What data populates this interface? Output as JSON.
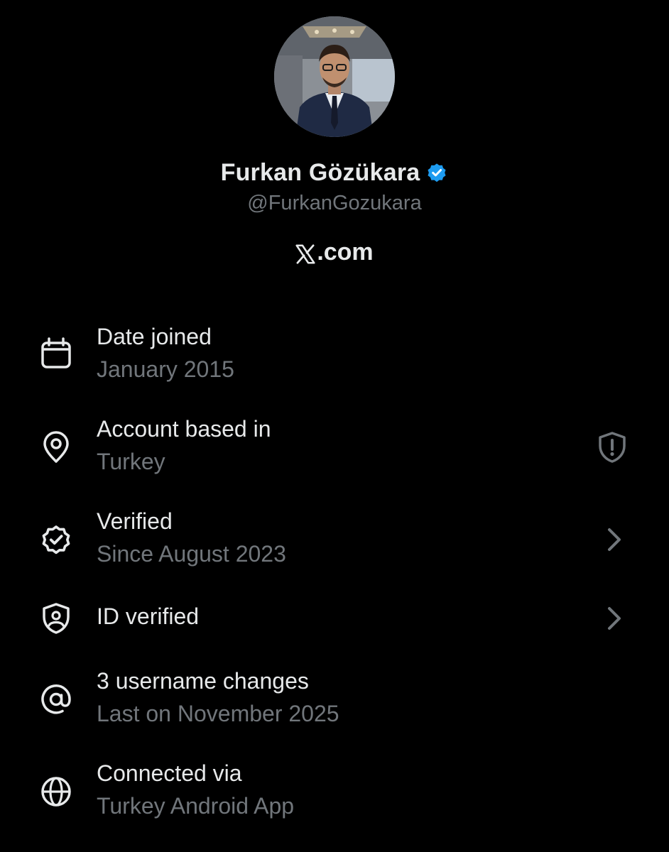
{
  "profile": {
    "display_name": "Furkan Gözükara",
    "handle": "@FurkanGozukara",
    "avatar_icon": "profile-photo",
    "verified_badge_icon": "verified-checkmark-icon",
    "badge_color": "#1d9bf0"
  },
  "brand": {
    "logo_icon": "x-logo-icon",
    "suffix": ".com"
  },
  "details": {
    "date_joined": {
      "title": "Date joined",
      "value": "January 2015",
      "icon": "calendar-icon"
    },
    "account_based": {
      "title": "Account based in",
      "value": "Turkey",
      "icon": "location-pin-icon",
      "trailing_icon": "shield-alert-icon"
    },
    "verified": {
      "title": "Verified",
      "value": "Since August 2023",
      "icon": "verified-badge-icon",
      "trailing_icon": "chevron-right-icon"
    },
    "id_verified": {
      "title": "ID verified",
      "icon": "id-shield-icon",
      "trailing_icon": "chevron-right-icon"
    },
    "username_changes": {
      "title": "3 username changes",
      "value": "Last on November 2025",
      "icon": "at-sign-icon"
    },
    "connected_via": {
      "title": "Connected via",
      "value": "Turkey Android App",
      "icon": "globe-icon"
    }
  },
  "colors": {
    "background": "#000000",
    "primary_text": "#e7e9ea",
    "secondary_text": "#71767b",
    "accent": "#1d9bf0"
  }
}
